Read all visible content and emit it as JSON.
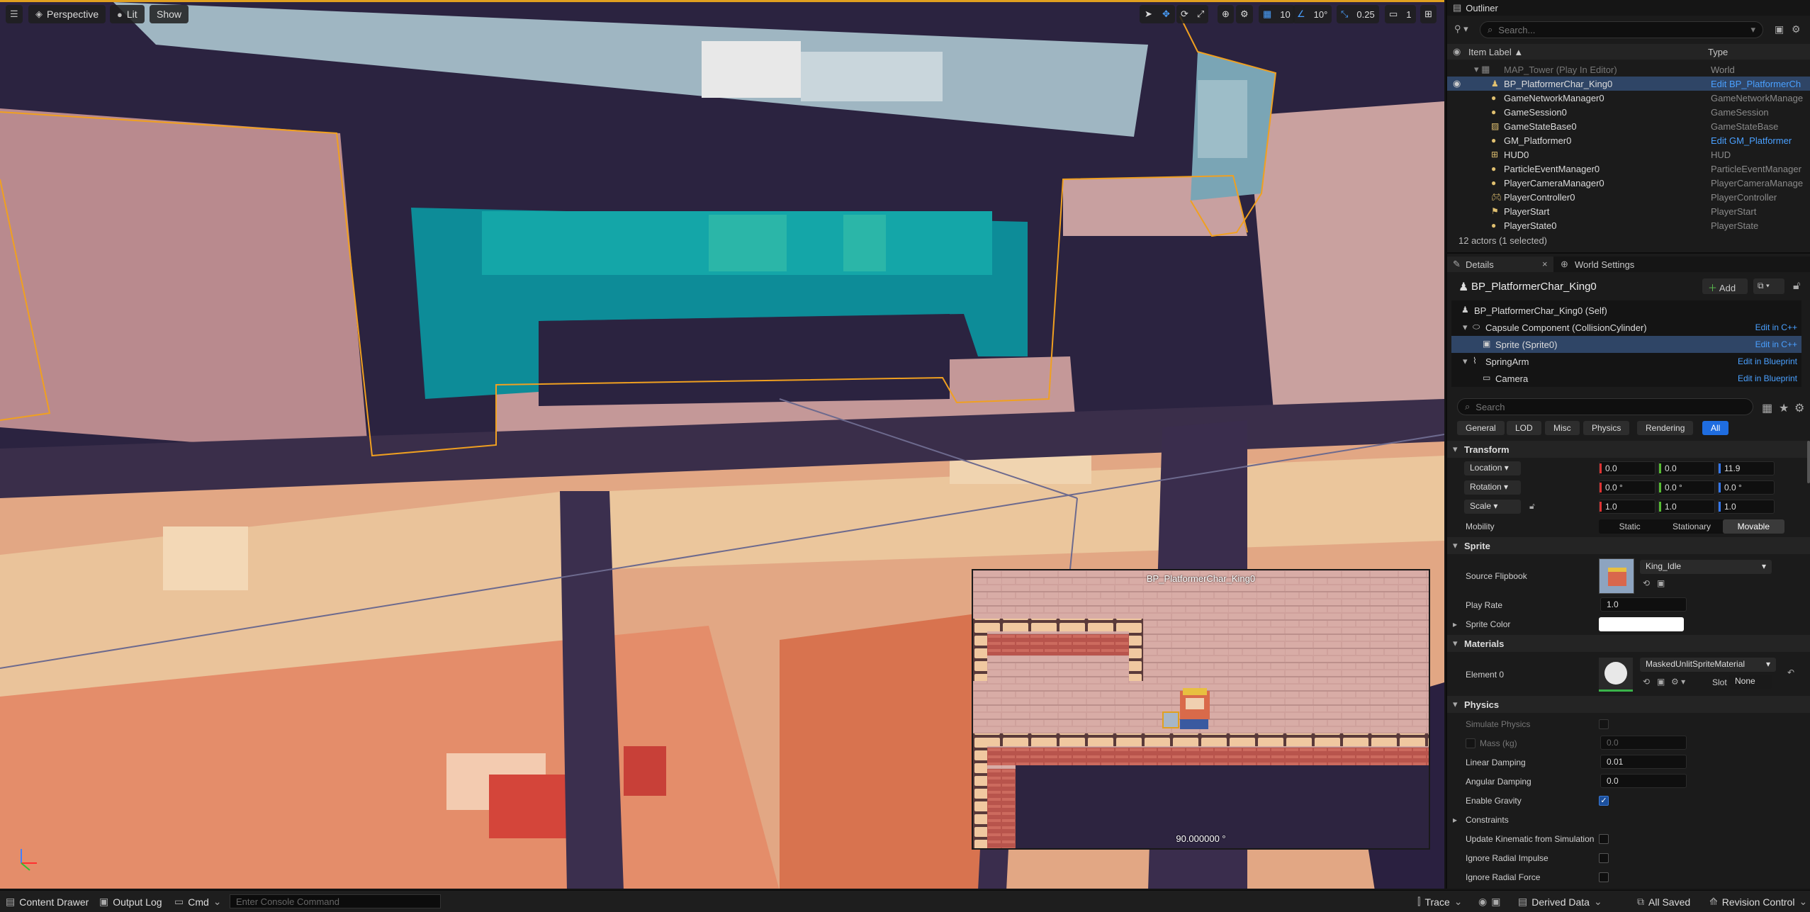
{
  "viewport": {
    "menu_icon": "hamburger-icon",
    "perspective_label": "Perspective",
    "lit_label": "Lit",
    "show_label": "Show",
    "grid_snap": "10",
    "angle_snap": "10°",
    "scale_snap": "0.25",
    "camera_speed": "1",
    "pip_title": "BP_PlatformerChar_King0",
    "pip_angle": "90.000000 °",
    "accent_color": "#e0a020"
  },
  "outliner": {
    "title": "Outliner",
    "search_placeholder": "Search...",
    "col_label": "Item Label ▲",
    "col_type": "Type",
    "rows": [
      {
        "label": "MAP_Tower (Play In Editor)",
        "type": "World"
      },
      {
        "label": "BP_PlatformerChar_King0",
        "type": "Edit BP_PlatformerCh"
      },
      {
        "label": "GameNetworkManager0",
        "type": "GameNetworkManage"
      },
      {
        "label": "GameSession0",
        "type": "GameSession"
      },
      {
        "label": "GameStateBase0",
        "type": "GameStateBase"
      },
      {
        "label": "GM_Platformer0",
        "type": "Edit GM_Platformer"
      },
      {
        "label": "HUD0",
        "type": "HUD"
      },
      {
        "label": "ParticleEventManager0",
        "type": "ParticleEventManager"
      },
      {
        "label": "PlayerCameraManager0",
        "type": "PlayerCameraManage"
      },
      {
        "label": "PlayerController0",
        "type": "PlayerController"
      },
      {
        "label": "PlayerStart",
        "type": "PlayerStart"
      },
      {
        "label": "PlayerState0",
        "type": "PlayerState"
      }
    ],
    "status": "12 actors (1 selected)"
  },
  "details": {
    "tab_details": "Details",
    "tab_world": "World Settings",
    "actor_name": "BP_PlatformerChar_King0",
    "add_label": "Add",
    "components": [
      {
        "label": "BP_PlatformerChar_King0 (Self)",
        "action": ""
      },
      {
        "label": "Capsule Component (CollisionCylinder)",
        "action": "Edit in C++"
      },
      {
        "label": "Sprite (Sprite0)",
        "action": "Edit in C++"
      },
      {
        "label": "SpringArm",
        "action": "Edit in Blueprint"
      },
      {
        "label": "Camera",
        "action": "Edit in Blueprint"
      }
    ],
    "search_placeholder": "Search",
    "filters": [
      "General",
      "LOD",
      "Misc",
      "Physics",
      "Rendering",
      "All"
    ],
    "transform": {
      "section": "Transform",
      "location_label": "Location",
      "location": [
        "0.0",
        "0.0",
        "11.9"
      ],
      "rotation_label": "Rotation",
      "rotation": [
        "0.0 °",
        "0.0 °",
        "0.0 °"
      ],
      "scale_label": "Scale",
      "scale": [
        "1.0",
        "1.0",
        "1.0"
      ],
      "mobility_label": "Mobility",
      "mobility": [
        "Static",
        "Stationary",
        "Movable"
      ]
    },
    "sprite": {
      "section": "Sprite",
      "flipbook_label": "Source Flipbook",
      "flipbook_value": "King_Idle",
      "playrate_label": "Play Rate",
      "playrate_value": "1.0",
      "color_label": "Sprite Color"
    },
    "materials": {
      "section": "Materials",
      "element_label": "Element 0",
      "material_value": "MaskedUnlitSpriteMaterial",
      "slot_label": "Slot",
      "slot_value": "None"
    },
    "physics": {
      "section": "Physics",
      "simulate_label": "Simulate Physics",
      "mass_label": "Mass (kg)",
      "mass_value": "0.0",
      "linear_label": "Linear Damping",
      "linear_value": "0.01",
      "angular_label": "Angular Damping",
      "angular_value": "0.0",
      "gravity_label": "Enable Gravity",
      "constraints_label": "Constraints",
      "kinematic_label": "Update Kinematic from Simulation",
      "radial_impulse_label": "Ignore Radial Impulse",
      "radial_force_label": "Ignore Radial Force"
    }
  },
  "bottom_bar": {
    "content_drawer": "Content Drawer",
    "output_log": "Output Log",
    "cmd": "Cmd",
    "console_placeholder": "Enter Console Command",
    "trace": "Trace",
    "derived_data": "Derived Data",
    "all_saved": "All Saved",
    "revision_control": "Revision Control"
  }
}
